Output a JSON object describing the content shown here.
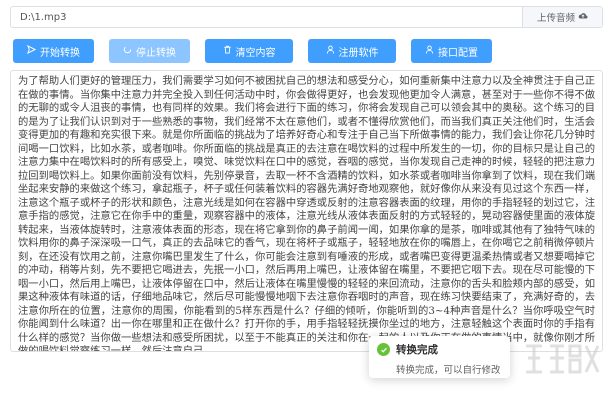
{
  "file": {
    "path": "D:\\1.mp3",
    "upload_label": "上传音频"
  },
  "toolbar": {
    "buttons": [
      {
        "label": "开始转换",
        "icon": "send-icon"
      },
      {
        "label": "停止转换",
        "icon": "loading-icon"
      },
      {
        "label": "清空内容",
        "icon": "trash-icon"
      },
      {
        "label": "注册软件",
        "icon": "user-icon"
      },
      {
        "label": "接口配置",
        "icon": "user-icon"
      }
    ]
  },
  "content": {
    "text": "为了帮助人们更好的管理压力，我们需要学习如何不被困扰自己的想法和感受分心，如何重新集中注意力以及全神贯注于自己正在做的事情。当你集中注意力并完全投入到任何活动中时，你会做得更好，也会发现他更加令人满意，甚至对于一些你不得不做的无聊的或令人沮丧的事情，也有同样的效果。我们将会进行下面的练习，你将会发现自己可以领会其中的奥秘。这个练习的目的是为了让我们认识到对于一些熟悉的事物，我们经常不太在意他们，或者不懂得欣赏他们，而当我们真正关注他们时，生活会变得更加的有趣和充实很下来。就是你所面临的挑战为了培养好奇心和专注于自己当下所做事情的能力，我们会让你花几分钟时间喝一口饮料，比如水茶，或者咖啡。你所面临的挑战是真正的去注意在喝饮料的过程中所发生的一切，你的目标只是让自己的注意力集中在喝饮料时的所有感受上，嗅觉、味觉饮料在口中的感觉，吞咽的感觉，当你发现自己走神的时候，轻轻的把注意力拉回到喝饮料上。如果你面前没有饮料，先别停录音，去取一杯不含酒精的饮料，如水茶或者咖啡当你拿到了饮料，现在我们端坐起来安静的来做这个练习，拿起瓶子，杯子或任何装着饮料的容器先满好奇地观察他，就好像你从来没有见过这个东西一样，注意这个瓶子或杯子的形状和颜色，注意光线是如何在容器中穿透或反射的注意容器表面的纹理，用你的手指轻轻的划过它，注意手指的感觉，注意它在你手中的重量，观察容器中的液体，注意光线从液体表面反射的方式轻轻的，晃动容器使里面的液体旋转起来，当液体旋转时，注意液体表面的形态，现在将它拿到你的鼻子前闻一闻，如果你拿的是茶，咖啡或其他有了独特气味的饮料用你的鼻子深深吸一口气，真正的去品味它的香气，现在将杯子或瓶子，轻轻地放在你的嘴唇上，在你喝它之前稍微停顿片刻，在还没有饮用之前，注意你嘴巴里发生了什么，你可能会注意到有唾液的形成，或者嘴巴变得更温柔热情或者又想要喝掉它的冲动，稍等片刻，先不要把它喝进去，先抿一小口，然后再用上嘴巴，让液体留在嘴里，不要把它咽下去。现在尽可能慢的下咽一小口，然后用上嘴巴，让液体停留在口中，然后让液体在嘴里慢慢的轻轻的来回流动，注意你的舌头和脸颊内部的感受，如果这种液体有味道的话，仔细地品味它，然后尽可能慢慢地咽下去注意你吞咽时的声音，现在练习快要结束了，充满好奇的，去注意你所在的位置，注意你的周围，你能看到的5样东西是什么？仔细的倾听，你能听到的3~4种声音是什么？当你呼吸空气时你能闻到什么味道？出一你在哪里和正在做什么？打开你的手，用手指轻轻抚摸你坐过的地方，注意轻触这个表面时你的手指有什么样的感觉？当你做一些想法和感受所困扰，以至于不能真正的关注和你在一起的人以及你正在做的事情当中，就像你刚才所做的喝饮料觉察练习一样，然后注意自己"
  },
  "toast": {
    "title": "转换完成",
    "message": "转换完成，可以自行修改"
  },
  "colors": {
    "primary": "#409eff",
    "primary_disabled": "#8cc5ff",
    "success": "#67c23a"
  }
}
